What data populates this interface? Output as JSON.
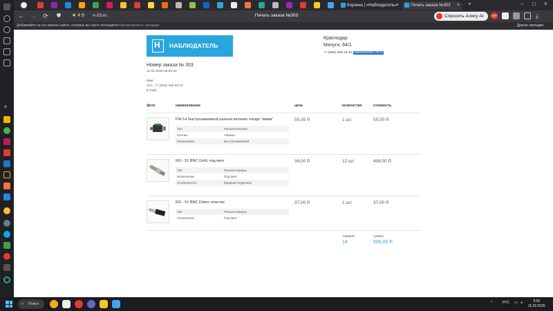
{
  "browser": {
    "tabs": [
      {
        "label": "Корзина | «Наблюдатель»"
      },
      {
        "label": "Печать заказа №303"
      }
    ],
    "rating": "4.9",
    "url": "n-23.ru",
    "page_title": "Печать заказа №303",
    "alice_label": "Спросить Алису AI",
    "badge": "ABP",
    "bookmarks_prompt": "Добавляйте на эту панель сайты, которые вы часто посещаете.",
    "bookmarks_import": "Импортировать закладки",
    "bookmarks_other": "Другие закладки"
  },
  "shop": {
    "logo_text": "НАБЛЮДАТЕЛЬ",
    "logo_letter": "H",
    "city": "Краснодар",
    "street": "Мачуги, 64/1",
    "phone": "+7 (988) 386-10-40",
    "email": "nabludatel@n-23.ru"
  },
  "order": {
    "number": "Номер заказа № 303",
    "datetime": "11.02.2026 09:02:04",
    "customer_name": "Имя:",
    "customer_phone": "Тел.: +7 (918) 445-92-07",
    "customer_email": "E-mail:"
  },
  "table": {
    "headers": [
      "фото",
      "наименование",
      "цена",
      "количество",
      "стоимость"
    ],
    "items": [
      {
        "name": "FW-14 быстрозажимной разъем питания гнездо \"мама\"",
        "price": "55,00 Р.",
        "qty": "1 шт.",
        "total": "55,00 Р.",
        "attrs": [
          {
            "k": "Тип",
            "v": "Разъем питания"
          },
          {
            "k": "Контакт",
            "v": "«Мама»"
          },
          {
            "k": "Назначение",
            "v": "Быстрозажимной"
          }
        ]
      },
      {
        "name": "RG - 51 BNC Gold, под винт",
        "price": "34,00 Р.",
        "qty": "12 шт.",
        "total": "408,00 Р.",
        "attrs": [
          {
            "k": "Тип",
            "v": "Разъем камеры"
          },
          {
            "k": "Назначение",
            "v": "Под винт"
          },
          {
            "k": "Особенности",
            "v": "Медный сердечник"
          }
        ]
      },
      {
        "name": "RG - 51 BNC Eletec пластик",
        "price": "37,00 Р.",
        "qty": "1 шт.",
        "total": "37,00 Р.",
        "attrs": [
          {
            "k": "Тип",
            "v": "Разъем камеры"
          },
          {
            "k": "Назначение",
            "v": "Под винт"
          }
        ]
      }
    ]
  },
  "totals": {
    "goods_label": "товаров:",
    "goods_value": "14",
    "sum_label": "сумма:",
    "sum_value": "500,00 Р."
  },
  "taskbar": {
    "search_label": "Поиск",
    "lang": "РУС",
    "time": "9:05",
    "date": "11.02.2026"
  },
  "colors": {
    "brand": "#2aa6df",
    "selection": "#1b6ccf",
    "alice": "#e8362b"
  }
}
